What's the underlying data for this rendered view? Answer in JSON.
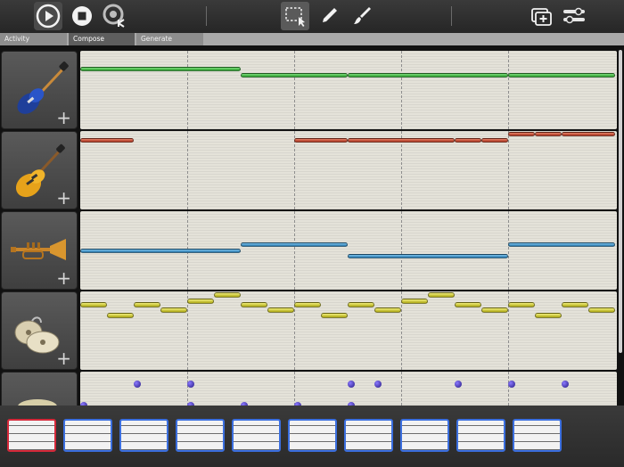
{
  "tabs": [
    "Activity",
    "Compose",
    "Generate"
  ],
  "colors": {
    "selected_pattern": "#d6293a",
    "pattern_border": "#3b6fe0"
  },
  "toolbar": {
    "left_icons": [
      "play-icon",
      "stop-icon",
      "metronome-icon"
    ],
    "center_icons": [
      "select-tool-icon",
      "pencil-icon",
      "brush-icon"
    ],
    "right_icons": [
      "add-pattern-icon",
      "settings-sliders-icon"
    ]
  },
  "tracks": [
    {
      "instrument": "bass-guitar",
      "color": "green"
    },
    {
      "instrument": "electric-guitar",
      "color": "red"
    },
    {
      "instrument": "trumpet",
      "color": "blue"
    },
    {
      "instrument": "cymbals",
      "color": "yellow"
    },
    {
      "instrument": "drums",
      "color": "purple"
    }
  ],
  "patterns": {
    "count": 10,
    "selected_index": 0
  }
}
